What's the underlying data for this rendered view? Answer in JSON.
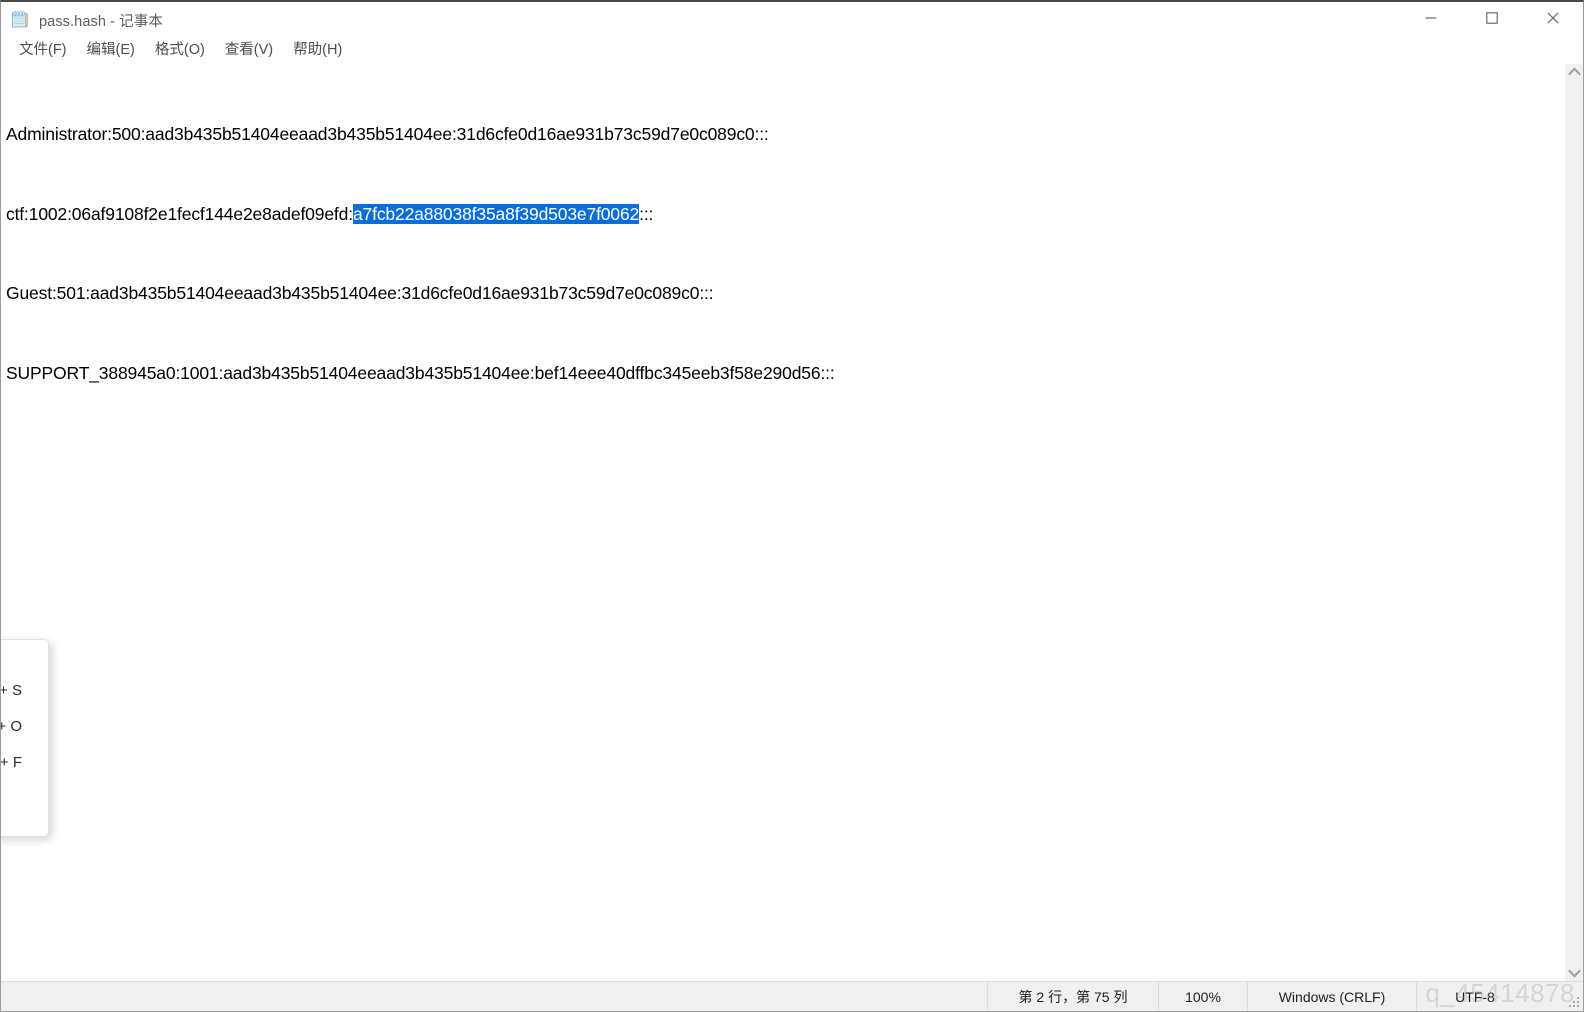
{
  "window": {
    "title": "pass.hash - 记事本",
    "icon": "notepad-icon",
    "controls": {
      "minimize": "minimize-icon",
      "maximize": "maximize-icon",
      "close": "close-icon"
    }
  },
  "menubar": {
    "items": [
      {
        "label": "文件(F)"
      },
      {
        "label": "编辑(E)"
      },
      {
        "label": "格式(O)"
      },
      {
        "label": "查看(V)"
      },
      {
        "label": "帮助(H)"
      }
    ]
  },
  "editor": {
    "lines": [
      {
        "before": "Administrator:500:aad3b435b51404eeaad3b435b51404ee:31d6cfe0d16ae931b73c59d7e0c089c0:::",
        "selected": "",
        "after": ""
      },
      {
        "before": "ctf:1002:06af9108f2e1fecf144e2e8adef09efd:",
        "selected": "a7fcb22a88038f35a8f39d503e7f0062",
        "after": ":::"
      },
      {
        "before": "Guest:501:aad3b435b51404eeaad3b435b51404ee:31d6cfe0d16ae931b73c59d7e0c089c0:::",
        "selected": "",
        "after": ""
      },
      {
        "before": "SUPPORT_388945a0:1001:aad3b435b51404eeaad3b435b51404ee:bef14eee40dffbc345eeb3f58e290d56:::",
        "selected": "",
        "after": ""
      }
    ],
    "selection_color": "#0a6ed6"
  },
  "statusbar": {
    "position": "第 2 行，第 75 列",
    "zoom": "100%",
    "line_ending": "Windows (CRLF)",
    "encoding": "UTF-8"
  },
  "watermark": {
    "text": "q_45414878"
  },
  "clipped_menu": {
    "rows": [
      {
        "shortcut": "+ S"
      },
      {
        "shortcut": "+ O"
      },
      {
        "shortcut": "+ F"
      }
    ]
  }
}
